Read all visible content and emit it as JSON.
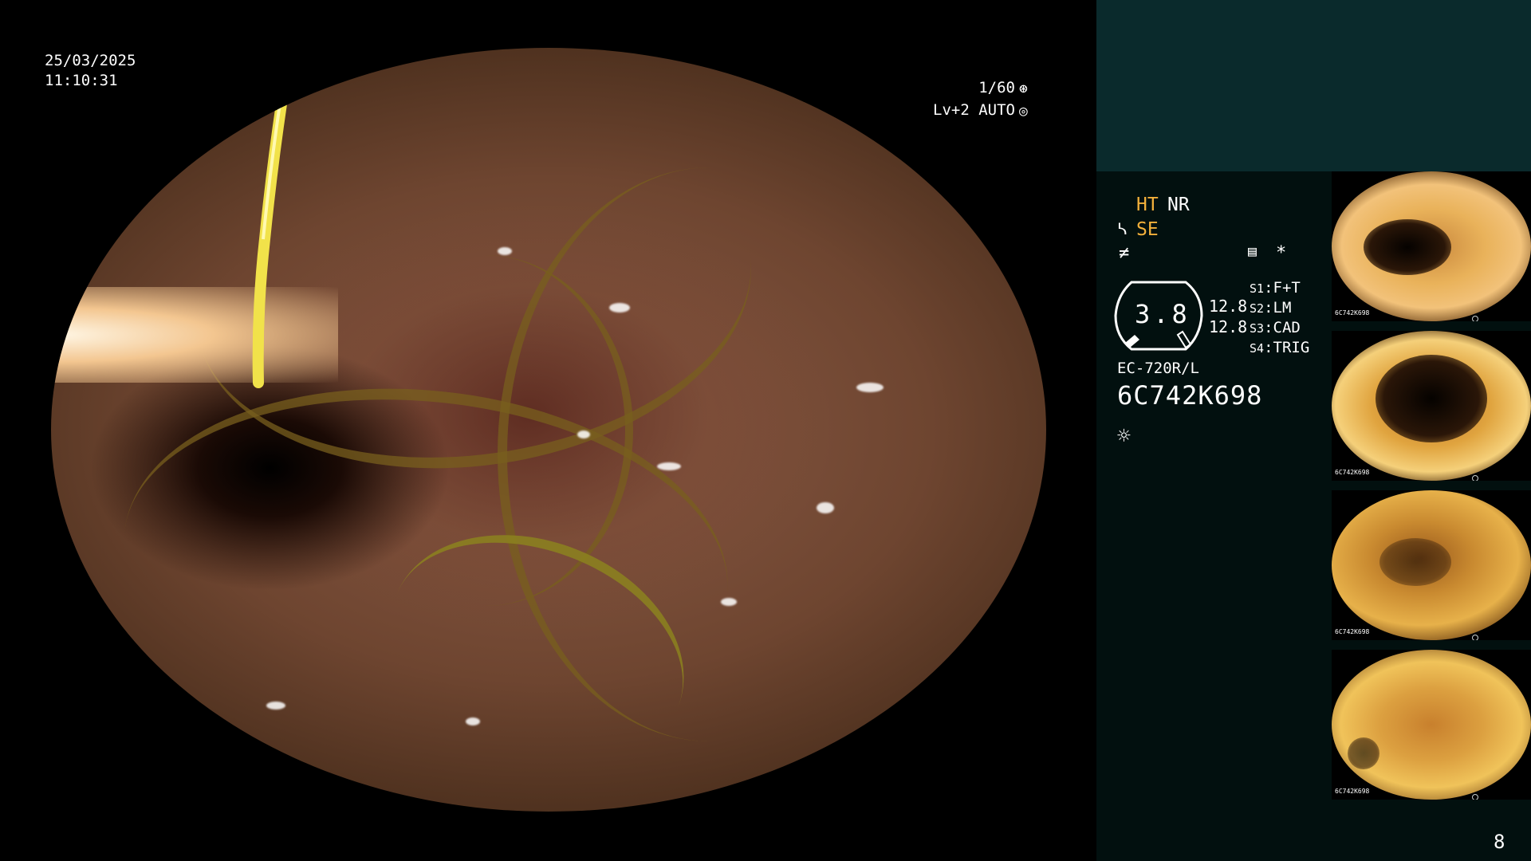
{
  "osd": {
    "date": "25/03/2025",
    "time": "11:10:31",
    "shutter": "1/60",
    "iris": "Lv+2 AUTO",
    "shutter_icon": "⊛",
    "iris_icon": "◎"
  },
  "panel": {
    "ht": "HT",
    "nr": "NR",
    "se": "SE",
    "se_icon": "ᓴ",
    "f_icon": "≠",
    "memory_icon": "▤",
    "star": "*",
    "zoom_value": "3.8",
    "param_1": "12.8",
    "param_2": "12.8",
    "switches": [
      {
        "key": "S1",
        "value": "F+T"
      },
      {
        "key": "S2",
        "value": "LM"
      },
      {
        "key": "S3",
        "value": "CAD"
      },
      {
        "key": "S4",
        "value": "TRIG"
      }
    ],
    "scope_model": "EC-720R/L",
    "scope_serial": "6C742K698",
    "light_icon": "☼"
  },
  "thumbnails": [
    {
      "caption": "6C742K698"
    },
    {
      "caption": "6C742K698"
    },
    {
      "caption": "6C742K698"
    },
    {
      "caption": "6C742K698"
    }
  ],
  "page_number": "8",
  "colors": {
    "accent_orange": "#f4b13b",
    "panel_header": "#0a2a2c",
    "panel_body": "#02100f"
  }
}
